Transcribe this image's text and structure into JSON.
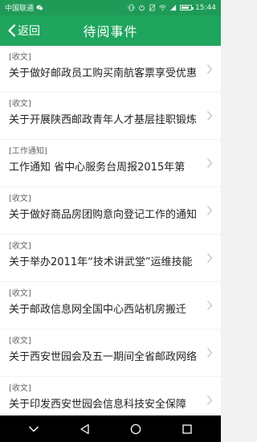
{
  "status_bar": {
    "carrier": "中国联通",
    "time": "15:44"
  },
  "header": {
    "back_label": "返回",
    "title": "待阅事件"
  },
  "items": [
    {
      "tag": "[收文]",
      "title": "关于做好邮政员工购买南航客票享受优惠"
    },
    {
      "tag": "[收文]",
      "title": "关于开展陕西邮政青年人才基层挂职锻炼"
    },
    {
      "tag": "[工作通知]",
      "title": "工作通知 省中心服务台周报2015年第"
    },
    {
      "tag": "[收文]",
      "title": "关于做好商品房团购意向登记工作的通知"
    },
    {
      "tag": "[收文]",
      "title": "关于举办2011年“技术讲武堂”运维技能"
    },
    {
      "tag": "[收文]",
      "title": "关于邮政信息网全国中心西站机房搬迁"
    },
    {
      "tag": "[收文]",
      "title": "关于西安世园会及五一期间全省邮政网络"
    },
    {
      "tag": "[收文]",
      "title": "关于印发西安世园会信息科技安全保障"
    }
  ],
  "icons": {
    "back": "back-chevron-icon",
    "item": "chevron-right-icon",
    "nav": [
      "nav-down-icon",
      "nav-back-icon",
      "nav-home-icon",
      "nav-recents-icon"
    ]
  },
  "colors": {
    "app_bar": "#1fa55d",
    "status_bar": "#1f9a57"
  }
}
